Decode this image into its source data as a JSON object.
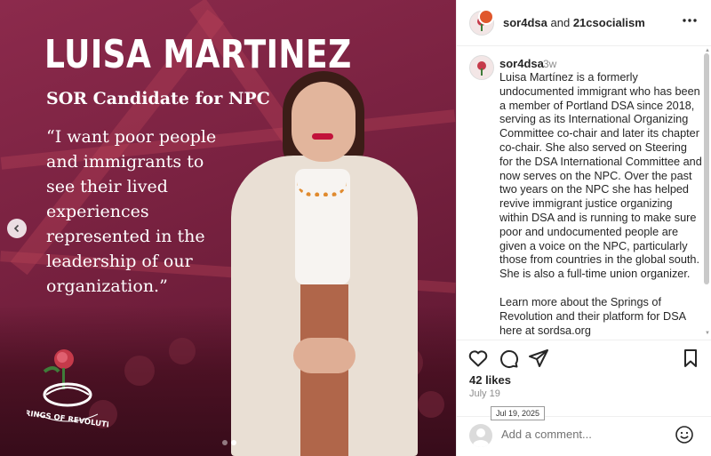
{
  "media": {
    "name": "LUISA MARTINEZ",
    "subtitle": "SOR Candidate for NPC",
    "quote": "“I want poor people and immigrants to see their lived experiences represented in the leadership of our organization.”",
    "logo_text": "SPRINGS OF REVOLUTION",
    "carousel_index": 2,
    "carousel_total": 2
  },
  "header": {
    "user1": "sor4dsa",
    "joiner": "and",
    "user2": "21csocialism",
    "more_icon": "more-horizontal-icon"
  },
  "caption": {
    "username": "sor4dsa",
    "time": "3w",
    "text": "Luisa Martínez is a formerly undocumented immigrant who has been a member of Portland DSA since 2018, serving as its International Organizing Committee co-chair and later its chapter co-chair. She also served on Steering for the DSA International Committee and now serves on the NPC. Over the past two years on the NPC she has helped revive immigrant justice organizing within DSA and is running to make sure poor and undocumented people are given a voice on the NPC, particularly those from countries in the global south. She is also a full-time union organizer.",
    "more": "Learn more about the Springs of Revolution and their platform for DSA here at sordsa.org"
  },
  "stats": {
    "likes": "42 likes",
    "date": "July 19",
    "tooltip": "Jul 19, 2025"
  },
  "comment": {
    "placeholder": "Add a comment..."
  },
  "colors": {
    "media_bg": "#7a2241",
    "accent_red": "#c2123a",
    "muted": "#8e8e8e"
  }
}
